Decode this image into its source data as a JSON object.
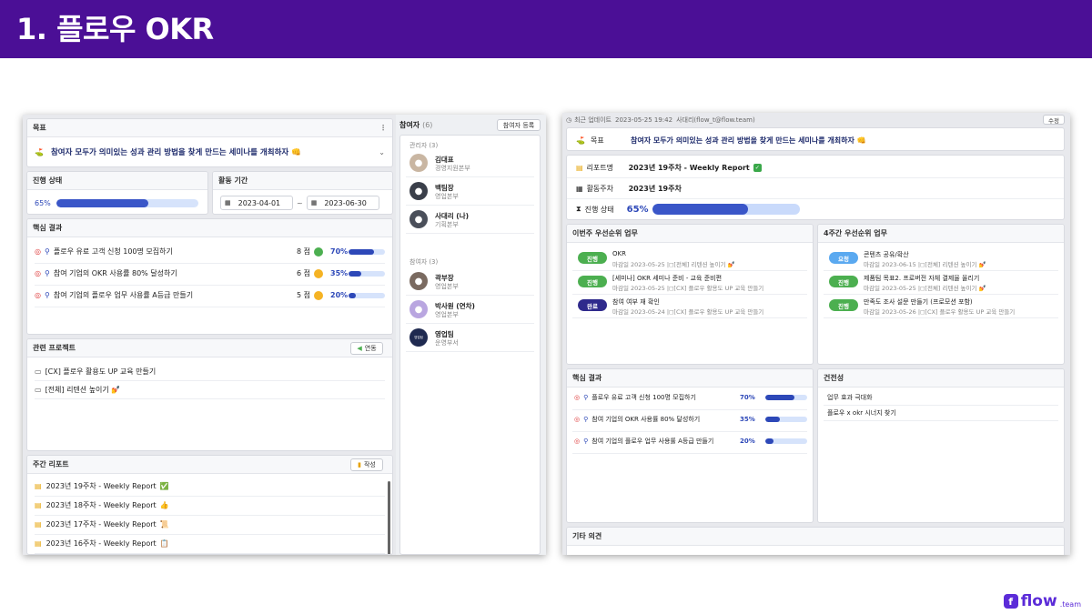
{
  "slide": {
    "title": "1. 플로우 OKR"
  },
  "brand": {
    "logo_text": "flow",
    "logo_suffix": ".team",
    "accent": "#4b0f96"
  },
  "left": {
    "goal": {
      "header": "목표",
      "text": "참여자 모두가 의미있는 성과 관리 방법을 찾게 만드는 세미나를 개최하자 👊"
    },
    "progress": {
      "header": "진행 상태",
      "percent": "65%",
      "value": 65
    },
    "period": {
      "header": "활동 기간",
      "start": "2023-04-01",
      "separator": "~",
      "end": "2023-06-30"
    },
    "key_results": {
      "header": "핵심 결과",
      "items": [
        {
          "text": "플로우 유료 고객 신청 100명 모집하기",
          "score": "8 점",
          "percent": "70%",
          "value": 70,
          "dot": "#4caf50"
        },
        {
          "text": "참여 기업의 OKR 사용률 80% 달성하기",
          "score": "6 점",
          "percent": "35%",
          "value": 35,
          "dot": "#f5b324"
        },
        {
          "text": "참여 기업의 플로우 업무 사용률 A등급 만들기",
          "score": "5 점",
          "percent": "20%",
          "value": 20,
          "dot": "#f5b324"
        }
      ]
    },
    "projects": {
      "header": "관련 프로젝트",
      "button": "연동",
      "items": [
        {
          "text": "[CX] 플로우 활용도 UP 교육 만들기"
        },
        {
          "text": "[전체] 리텐션 높이기 💅"
        }
      ]
    },
    "weekly": {
      "header": "주간 리포트",
      "button": "작성",
      "items": [
        {
          "text": "2023년 19주차 - Weekly Report",
          "emoji": "✅"
        },
        {
          "text": "2023년 18주차 - Weekly Report",
          "emoji": "👍"
        },
        {
          "text": "2023년 17주차 - Weekly Report",
          "emoji": "📜"
        },
        {
          "text": "2023년 16주차 - Weekly Report",
          "emoji": "📋"
        }
      ]
    },
    "participants": {
      "header": "참여자",
      "count": "(6)",
      "button": "참여자 등록",
      "managers_label": "관리자",
      "managers_count": "(3)",
      "managers": [
        {
          "name": "김대표",
          "dept": "경영지원본부"
        },
        {
          "name": "백팀장",
          "dept": "영업본부"
        },
        {
          "name": "사대리 (나)",
          "dept": "기획본부"
        }
      ],
      "members_label": "참여자",
      "members_count": "(3)",
      "members": [
        {
          "name": "곽부장",
          "dept": "영업본부"
        },
        {
          "name": "박사원 (연차)",
          "dept": "영업본부"
        },
        {
          "name": "영업팀",
          "dept": "운영부서",
          "badge": "영업팀"
        }
      ]
    }
  },
  "right": {
    "update": {
      "label": "최근 업데이트",
      "time": "2023-05-25 19:42",
      "user": "사대리(flow_t@flow.team)",
      "button": "수정"
    },
    "goal": {
      "label": "목표",
      "text": "참여자 모두가 의미있는 성과 관리 방법을 찾게 만드는 세미나를 개최하자 👊"
    },
    "report": {
      "report_label": "리포트명",
      "report_name": "2023년 19주차 - Weekly Report",
      "week_label": "활동주차",
      "week_value": "2023년  19주차",
      "status_label": "진행 상태",
      "status_percent": "65%",
      "status_value": 65
    },
    "this_week": {
      "header": "이번주 우선순위 업무",
      "items": [
        {
          "badge": "진행",
          "color": "#4caf50",
          "title": "OKR",
          "meta": "마감일 2023-05-25 |◻[전체] 리텐션 높이기 💅"
        },
        {
          "badge": "진행",
          "color": "#4caf50",
          "title": "[세미나] OKR 세미나 준비 - 교육 준비편",
          "meta": "마감일 2023-05-25 |◻[CX] 플로우 활용도 UP 교육 만들기"
        },
        {
          "badge": "완료",
          "color": "#2f2a8c",
          "title": "참여 여부 재 확인",
          "meta": "마감일 2023-05-24 |◻[CX] 플로우 활용도 UP 교육 만들기"
        }
      ]
    },
    "four_week": {
      "header": "4주간 우선순위 업무",
      "items": [
        {
          "badge": "요청",
          "color": "#5aa9f0",
          "title": "콘텐츠 공유/확산",
          "meta": "마감일 2023-06-15 |◻[전체] 리텐션 높이기 💅"
        },
        {
          "badge": "진행",
          "color": "#4caf50",
          "title": "제품팀 목표2. 프로버전 자체 결제율 올리기",
          "meta": "마감일 2023-05-25 |◻[전체] 리텐션 높이기 💅"
        },
        {
          "badge": "진행",
          "color": "#4caf50",
          "title": "만족도 조사 설문 만들기 (프로모션 포함)",
          "meta": "마감일 2023-05-26 |◻[CX] 플로우 활용도 UP 교육 만들기"
        }
      ]
    },
    "key_results": {
      "header": "핵심 결과",
      "items": [
        {
          "text": "플로우 유료 고객 신청 100명 모집하기",
          "percent": "70%",
          "value": 70
        },
        {
          "text": "참여 기업의 OKR 사용률 80% 달성하기",
          "percent": "35%",
          "value": 35
        },
        {
          "text": "참여 기업의 플로우 업무 사용률 A등급 만들기",
          "percent": "20%",
          "value": 20
        }
      ]
    },
    "suggestions": {
      "header": "건전성",
      "items": [
        {
          "text": "업무 효과 극대화"
        },
        {
          "text": "플로우 x okr 시너지 찾기"
        }
      ]
    },
    "other": {
      "header": "기타 의견"
    }
  }
}
